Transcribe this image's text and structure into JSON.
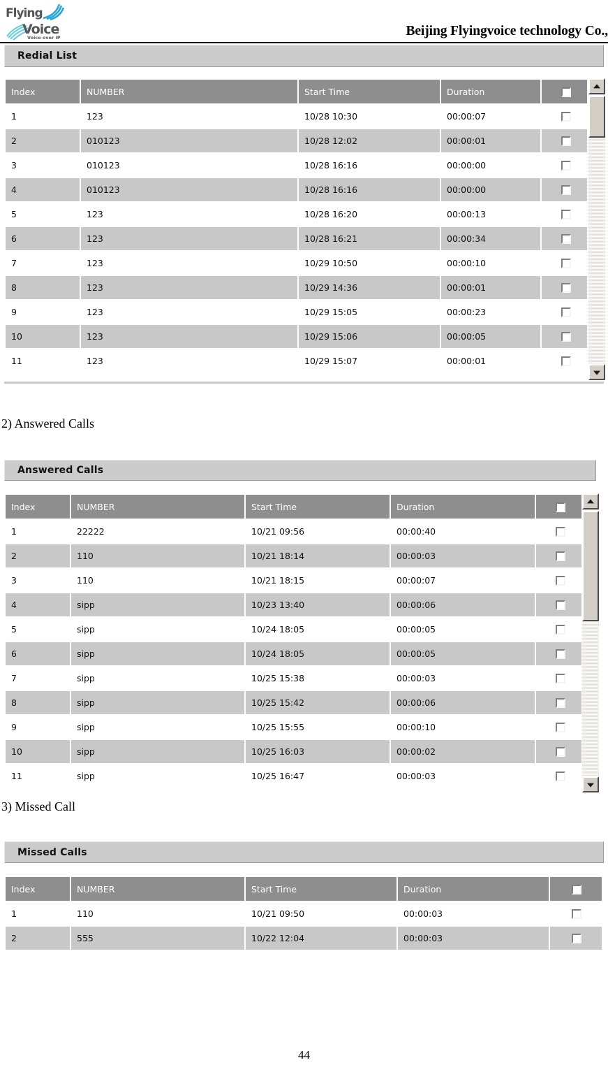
{
  "header": {
    "company_title": "Beijing Flyingvoice technology Co.,",
    "logo": {
      "line1": "Flying",
      "line2": "Voice",
      "tagline": "Voice over IP"
    }
  },
  "columns": [
    "Index",
    "NUMBER",
    "Start Time",
    "Duration",
    ""
  ],
  "sections": [
    {
      "id": "redial",
      "title": "Redial List",
      "caption": "",
      "rows": [
        {
          "index": "1",
          "number": "123",
          "start": "10/28 10:30",
          "duration": "00:00:07"
        },
        {
          "index": "2",
          "number": "010123",
          "start": "10/28 12:02",
          "duration": "00:00:01"
        },
        {
          "index": "3",
          "number": "010123",
          "start": "10/28 16:16",
          "duration": "00:00:00"
        },
        {
          "index": "4",
          "number": "010123",
          "start": "10/28 16:16",
          "duration": "00:00:00"
        },
        {
          "index": "5",
          "number": "123",
          "start": "10/28 16:20",
          "duration": "00:00:13"
        },
        {
          "index": "6",
          "number": "123",
          "start": "10/28 16:21",
          "duration": "00:00:34"
        },
        {
          "index": "7",
          "number": "123",
          "start": "10/29 10:50",
          "duration": "00:00:10"
        },
        {
          "index": "8",
          "number": "123",
          "start": "10/29 14:36",
          "duration": "00:00:01"
        },
        {
          "index": "9",
          "number": "123",
          "start": "10/29 15:05",
          "duration": "00:00:23"
        },
        {
          "index": "10",
          "number": "123",
          "start": "10/29 15:06",
          "duration": "00:00:05"
        },
        {
          "index": "11",
          "number": "123",
          "start": "10/29 15:07",
          "duration": "00:00:01"
        }
      ]
    },
    {
      "id": "answered",
      "title": "Answered Calls",
      "caption": "2) Answered Calls",
      "rows": [
        {
          "index": "1",
          "number": "22222",
          "start": "10/21 09:56",
          "duration": "00:00:40"
        },
        {
          "index": "2",
          "number": "110",
          "start": "10/21 18:14",
          "duration": "00:00:03"
        },
        {
          "index": "3",
          "number": "110",
          "start": "10/21 18:15",
          "duration": "00:00:07"
        },
        {
          "index": "4",
          "number": "sipp",
          "start": "10/23 13:40",
          "duration": "00:00:06"
        },
        {
          "index": "5",
          "number": "sipp",
          "start": "10/24 18:05",
          "duration": "00:00:05"
        },
        {
          "index": "6",
          "number": "sipp",
          "start": "10/24 18:05",
          "duration": "00:00:05"
        },
        {
          "index": "7",
          "number": "sipp",
          "start": "10/25 15:38",
          "duration": "00:00:03"
        },
        {
          "index": "8",
          "number": "sipp",
          "start": "10/25 15:42",
          "duration": "00:00:06"
        },
        {
          "index": "9",
          "number": "sipp",
          "start": "10/25 15:55",
          "duration": "00:00:10"
        },
        {
          "index": "10",
          "number": "sipp",
          "start": "10/25 16:03",
          "duration": "00:00:02"
        },
        {
          "index": "11",
          "number": "sipp",
          "start": "10/25 16:47",
          "duration": "00:00:03"
        }
      ]
    },
    {
      "id": "missed",
      "title": "Missed Calls",
      "caption": "3) Missed Call",
      "rows": [
        {
          "index": "1",
          "number": "110",
          "start": "10/21 09:50",
          "duration": "00:00:03"
        },
        {
          "index": "2",
          "number": "555",
          "start": "10/22 12:04",
          "duration": "00:00:03"
        }
      ]
    }
  ],
  "footer": {
    "page_number": "44"
  }
}
